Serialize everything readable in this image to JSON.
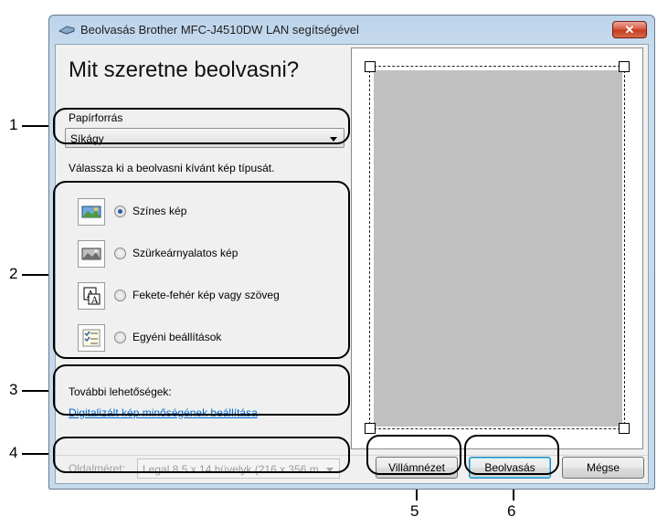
{
  "window": {
    "title": "Beolvasás Brother MFC-J4510DW LAN segítségével",
    "close_label": "✕"
  },
  "heading": "Mit szeretne beolvasni?",
  "paper_source": {
    "label": "Papírforrás",
    "value": "Síkágy"
  },
  "scan_type": {
    "prompt": "Válassza ki a beolvasni kívánt kép típusát.",
    "options": [
      {
        "label": "Színes kép",
        "icon": "color-photo-icon",
        "selected": true
      },
      {
        "label": "Szürkeárnyalatos kép",
        "icon": "grayscale-photo-icon",
        "selected": false
      },
      {
        "label": "Fekete-fehér kép vagy szöveg",
        "icon": "black-white-text-icon",
        "selected": false
      },
      {
        "label": "Egyéni beállítások",
        "icon": "custom-settings-icon",
        "selected": false
      }
    ]
  },
  "more_options": {
    "label": "További lehetőségek:",
    "link": "Digitalizált kép minőségének beállítása"
  },
  "page_size": {
    "label": "Oldalméret:",
    "value": "Legal 8.5 x 14 hüvelyk (216 x 356 mm)"
  },
  "buttons": {
    "preview": "Villámnézet",
    "scan": "Beolvasás",
    "cancel": "Mégse"
  },
  "callouts": [
    "1",
    "2",
    "3",
    "4",
    "5",
    "6"
  ]
}
